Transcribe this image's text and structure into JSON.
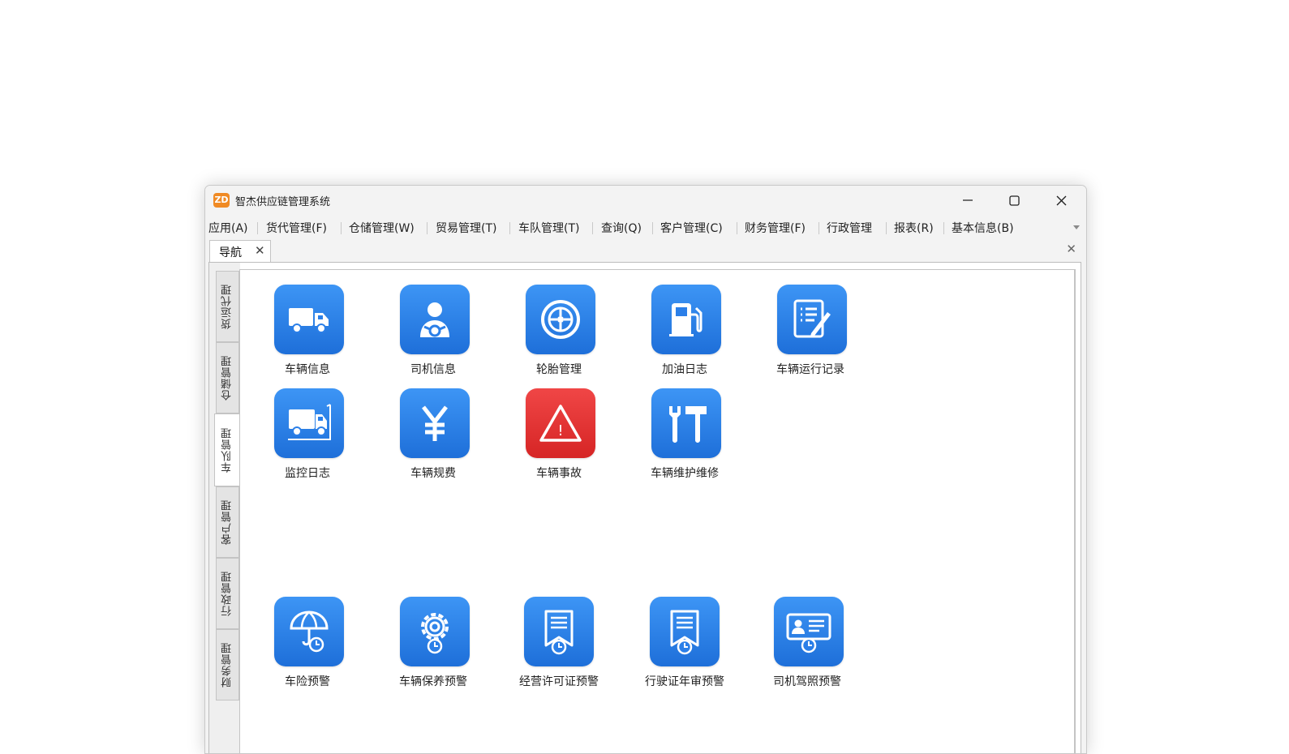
{
  "window": {
    "logo_text": "ZD",
    "title": "智杰供应链管理系统",
    "minimize_icon": "minimize-icon",
    "maximize_icon": "maximize-icon",
    "close_icon": "close-icon"
  },
  "menu": [
    "应用(A)",
    "货代管理(F)",
    "仓储管理(W)",
    "贸易管理(T)",
    "车队管理(T)",
    "查询(Q)",
    "客户管理(C)",
    "财务管理(F)",
    "行政管理",
    "报表(R)",
    "基本信息(B)"
  ],
  "tabs": {
    "active_label": "导航",
    "close_glyph": "✕",
    "strip_close_glyph": "✕"
  },
  "side_tabs": [
    "货运代理",
    "仓储管理",
    "车队管理",
    "客户管理",
    "行政管理",
    "财务管理"
  ],
  "active_side_tab": "车队管理",
  "tiles_row1": [
    {
      "label": "车辆信息",
      "icon": "truck-icon"
    },
    {
      "label": "司机信息",
      "icon": "driver-icon"
    },
    {
      "label": "轮胎管理",
      "icon": "tire-icon"
    },
    {
      "label": "加油日志",
      "icon": "fuel-pump-icon"
    },
    {
      "label": "车辆运行记录",
      "icon": "document-edit-icon"
    }
  ],
  "tiles_row2": [
    {
      "label": "监控日志",
      "icon": "truck-monitor-icon"
    },
    {
      "label": "车辆规费",
      "icon": "yen-icon"
    },
    {
      "label": "车辆事故",
      "icon": "warning-icon",
      "color": "#e53030"
    },
    {
      "label": "车辆维护维修",
      "icon": "tools-icon"
    }
  ],
  "tiles_row3": [
    {
      "label": "车险预警",
      "icon": "umbrella-clock-icon"
    },
    {
      "label": "车辆保养预警",
      "icon": "gear-clock-icon"
    },
    {
      "label": "经营许可证预警",
      "icon": "bookmark-clock-icon"
    },
    {
      "label": "行驶证年审预警",
      "icon": "bookmark-clock-icon"
    },
    {
      "label": "司机驾照预警",
      "icon": "id-card-clock-icon"
    }
  ],
  "colors": {
    "tile_blue": "#2b7fe8",
    "tile_red": "#e53030",
    "app_logo": "#f08a24"
  }
}
